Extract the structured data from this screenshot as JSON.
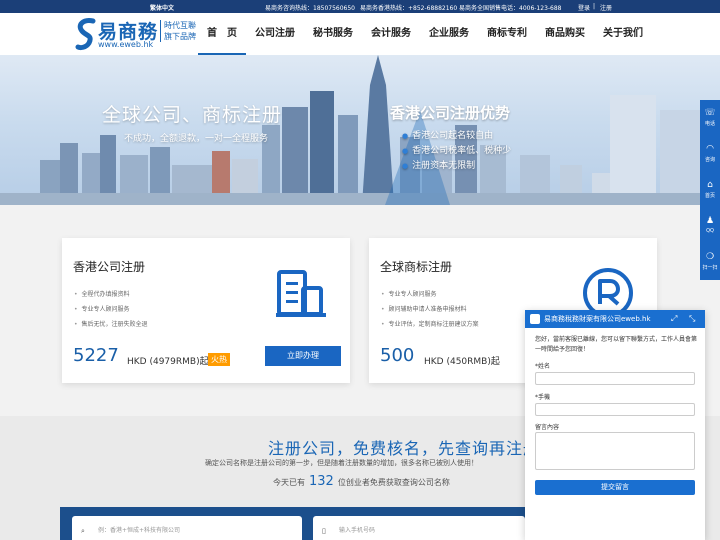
{
  "topbar": {
    "language": "繁体中文",
    "hotline_consult": "易商务咨询热线：18507560650",
    "hotline_hk": "易商务香港热线：+852-68882160",
    "hotline_sales": "易商务全国销售电话：4006-123-688",
    "login": "登录",
    "separator": "|",
    "register": "注册"
  },
  "header": {
    "logo_name": "易商務",
    "logo_url": "www.eweb.hk",
    "logo_tagline_1": "時代互聯",
    "logo_tagline_2": "旗下品牌",
    "nav": [
      {
        "label": "首　页"
      },
      {
        "label": "公司注册"
      },
      {
        "label": "秘书服务"
      },
      {
        "label": "会计服务"
      },
      {
        "label": "企业服务"
      },
      {
        "label": "商标专利"
      },
      {
        "label": "商品购买"
      },
      {
        "label": "关于我们"
      }
    ]
  },
  "banner": {
    "title": "全球公司、商标注册",
    "subtitle": "不成功，全额退款，一对一全程服务",
    "advantage_title": "香港公司注册优势",
    "advantages": [
      "香港公司起名较自由",
      "香港公司税率低、税种少",
      "注册资本无限制"
    ]
  },
  "cards": [
    {
      "title": "香港公司注册",
      "features": [
        "全程代办填报资料",
        "专业专人顾问服务",
        "售后无忧，注册失败全退"
      ],
      "price": "5227",
      "price_unit": "HKD (4979RMB)起",
      "badge": "火热",
      "button": "立即办理",
      "icon": "building-icon"
    },
    {
      "title": "全球商标注册",
      "features": [
        "专业专人顾问服务",
        "顾问辅助申请人准备申报材料",
        "专业评估，定制商标注册建议方案"
      ],
      "price": "500",
      "price_unit": "HKD (450RMB)起",
      "icon": "registered-trademark-icon"
    }
  ],
  "lower": {
    "title": "注册公司，免费核名，先查询再注册",
    "subtitle": "确定公司名称是注册公司的第一步，但是随着注册数量的增加，很多名称已被别人使用！",
    "count_prefix": "今天已有",
    "count": "132",
    "count_suffix": "位创业者免费获取查询公司名称",
    "company_placeholder": "例：香港+恒成+科技有限公司",
    "phone_placeholder": "输入手机号码"
  },
  "sidebar": {
    "items": [
      {
        "label": "电话",
        "icon": "phone-icon"
      },
      {
        "label": "咨询",
        "icon": "headset-icon"
      },
      {
        "label": "首页",
        "icon": "home-icon"
      },
      {
        "label": "QQ",
        "icon": "qq-icon"
      },
      {
        "label": "扫一扫",
        "icon": "wechat-icon"
      }
    ]
  },
  "chat": {
    "title": "易商務稅務財案有限公司eweb.hk",
    "message": "您好，當前客服已離線，您可以留下聯繫方式，工作人員會第一時間給予您回復！",
    "name_label": "*姓名",
    "phone_label": "*手機",
    "message_label": "留言內容",
    "submit": "提交留言"
  },
  "colors": {
    "brand": "#1a66b5",
    "topbar": "#1b3f78",
    "button": "#1a66c2",
    "hot_badge": "#ff9c00"
  }
}
